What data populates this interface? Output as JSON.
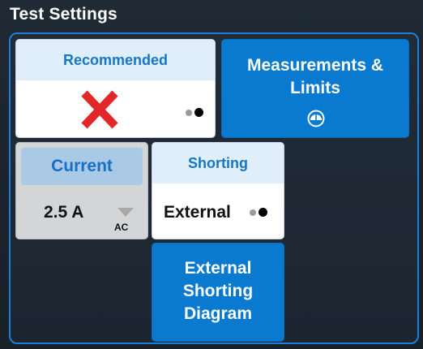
{
  "title": "Test Settings",
  "accent_color": "#0a7ad1",
  "tiles": {
    "recommended": {
      "label": "Recommended",
      "status_icon": "red-x-icon"
    },
    "measurements": {
      "label_line1": "Measurements &",
      "label_line2": "Limits",
      "icon": "gauge-icon"
    },
    "current": {
      "label": "Current",
      "value": "2.5 A",
      "subunit": "AC",
      "icon": "dropdown-triangle-icon"
    },
    "shorting": {
      "label": "Shorting",
      "value": "External"
    },
    "diagram": {
      "label_line1": "External",
      "label_line2": "Shorting",
      "label_line3": "Diagram"
    }
  }
}
